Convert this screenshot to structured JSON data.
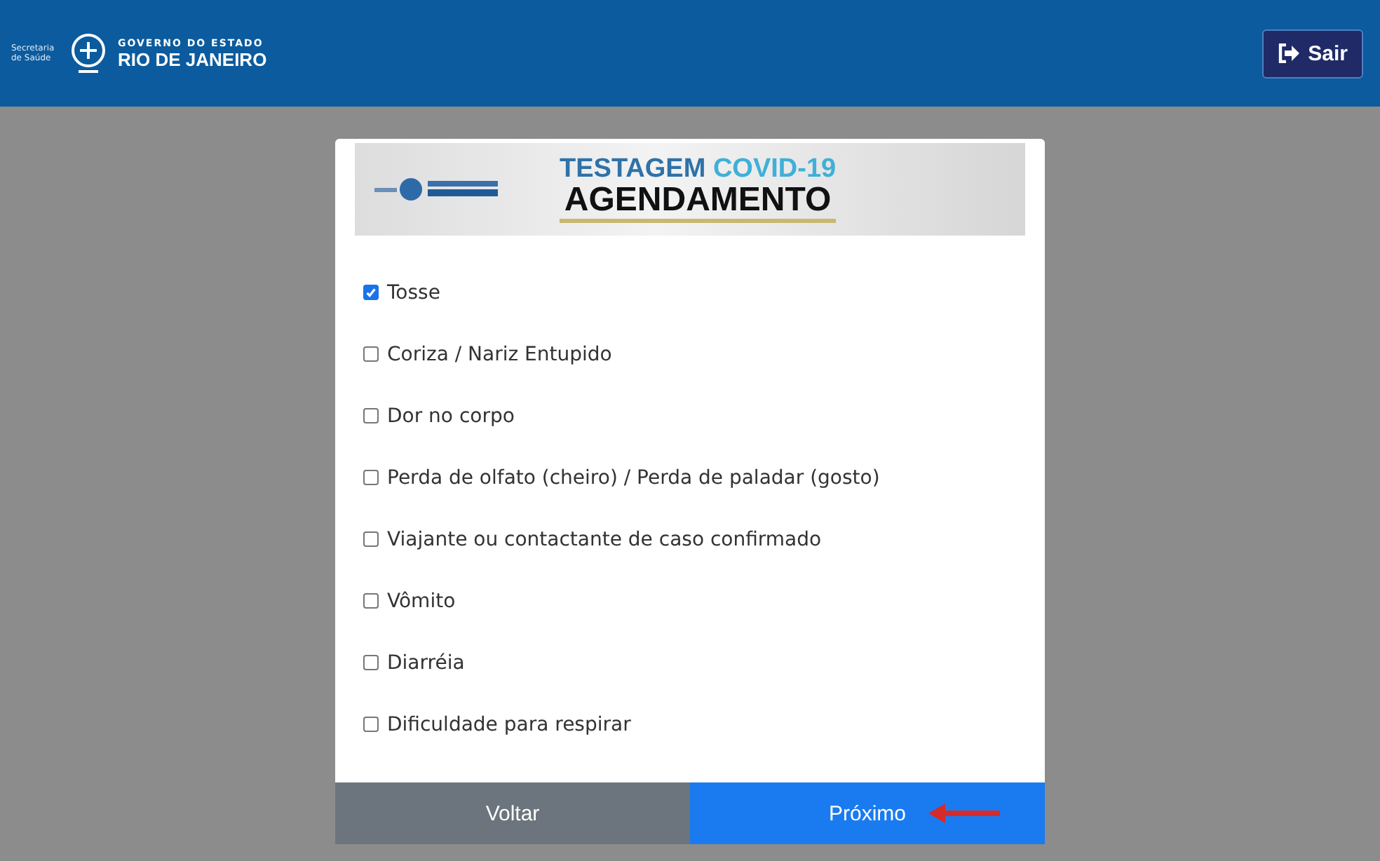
{
  "header": {
    "secretaria": "Secretaria de Saúde",
    "governo": "GOVERNO DO ESTADO",
    "estado": "RIO DE JANEIRO",
    "exit_button": "Sair"
  },
  "banner": {
    "title_part_1": "TESTAGEM",
    "title_part_2": "COVID-19",
    "subtitle": "AGENDAMENTO"
  },
  "symptoms": [
    {
      "label": "Tosse",
      "checked": true
    },
    {
      "label": "Coriza / Nariz Entupido",
      "checked": false
    },
    {
      "label": "Dor no corpo",
      "checked": false
    },
    {
      "label": "Perda de olfato (cheiro) / Perda de paladar (gosto)",
      "checked": false
    },
    {
      "label": "Viajante ou contactante de caso confirmado",
      "checked": false
    },
    {
      "label": "Vômito",
      "checked": false
    },
    {
      "label": "Diarréia",
      "checked": false
    },
    {
      "label": "Dificuldade para respirar",
      "checked": false
    }
  ],
  "buttons": {
    "back": "Voltar",
    "next": "Próximo"
  }
}
